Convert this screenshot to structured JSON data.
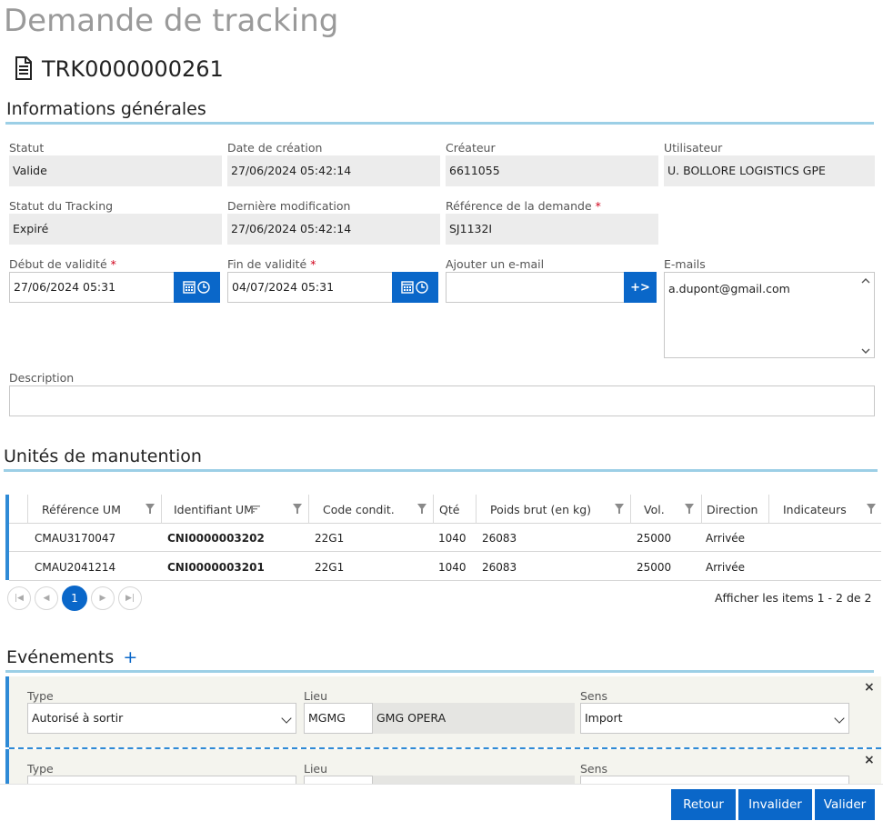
{
  "page": {
    "title": "Demande de tracking",
    "doc_id": "TRK0000000261"
  },
  "general": {
    "title": "Informations générales",
    "statut": {
      "label": "Statut",
      "value": "Valide"
    },
    "date_creation": {
      "label": "Date de création",
      "value": "27/06/2024 05:42:14"
    },
    "createur": {
      "label": "Créateur",
      "value": "6611055"
    },
    "utilisateur": {
      "label": "Utilisateur",
      "value": "U. BOLLORE LOGISTICS GPE"
    },
    "statut_tracking": {
      "label": "Statut du Tracking",
      "value": "Expiré"
    },
    "derniere_modif": {
      "label": "Dernière modification",
      "value": "27/06/2024 05:42:14"
    },
    "reference": {
      "label": "Référence de la demande",
      "required": "*",
      "value": "SJ1132I"
    },
    "debut_validite": {
      "label": "Début de validité",
      "required": "*",
      "value": "27/06/2024 05:31"
    },
    "fin_validite": {
      "label": "Fin de validité",
      "required": "*",
      "value": "04/07/2024 05:31"
    },
    "ajouter_email": {
      "label": "Ajouter un e-mail",
      "value": "",
      "button_symbol": "+>"
    },
    "emails": {
      "label": "E-mails",
      "value": "a.dupont@gmail.com"
    },
    "description": {
      "label": "Description",
      "value": ""
    }
  },
  "units": {
    "title": "Unités de manutention",
    "columns": [
      "Référence UM",
      "Identifiant UM",
      "Code condit.",
      "Qté",
      "Poids brut (en kg)",
      "Vol.",
      "Direction",
      "Indicateurs"
    ],
    "rows": [
      {
        "ref": "CMAU3170047",
        "id": "CNI0000003202",
        "code": "22G1",
        "qte": "1040",
        "poids": "26083",
        "vol": "25000",
        "direction": "Arrivée",
        "indicateurs": ""
      },
      {
        "ref": "CMAU2041214",
        "id": "CNI0000003201",
        "code": "22G1",
        "qte": "1040",
        "poids": "26083",
        "vol": "25000",
        "direction": "Arrivée",
        "indicateurs": ""
      }
    ],
    "pager": {
      "current_page": "1",
      "summary": "Afficher les items 1 - 2 de 2"
    }
  },
  "events": {
    "title": "Evénements",
    "add_symbol": "+",
    "items": [
      {
        "type_label": "Type",
        "type_value": "Autorisé à sortir",
        "lieu_label": "Lieu",
        "lieu_code": "MGMG",
        "lieu_name": "GMG OPERA",
        "sens_label": "Sens",
        "sens_value": "Import",
        "close": "×"
      },
      {
        "type_label": "Type",
        "type_value": "",
        "lieu_label": "Lieu",
        "lieu_code": "",
        "lieu_name": "",
        "sens_label": "Sens",
        "sens_value": "",
        "close": "×"
      }
    ]
  },
  "footer": {
    "retour": "Retour",
    "invalider": "Invalider",
    "valider": "Valider"
  },
  "colors": {
    "accent": "#0a67c9",
    "rule": "#9ccfe6",
    "readonly_bg": "#ececec",
    "event_bg": "#f4f4ee"
  }
}
